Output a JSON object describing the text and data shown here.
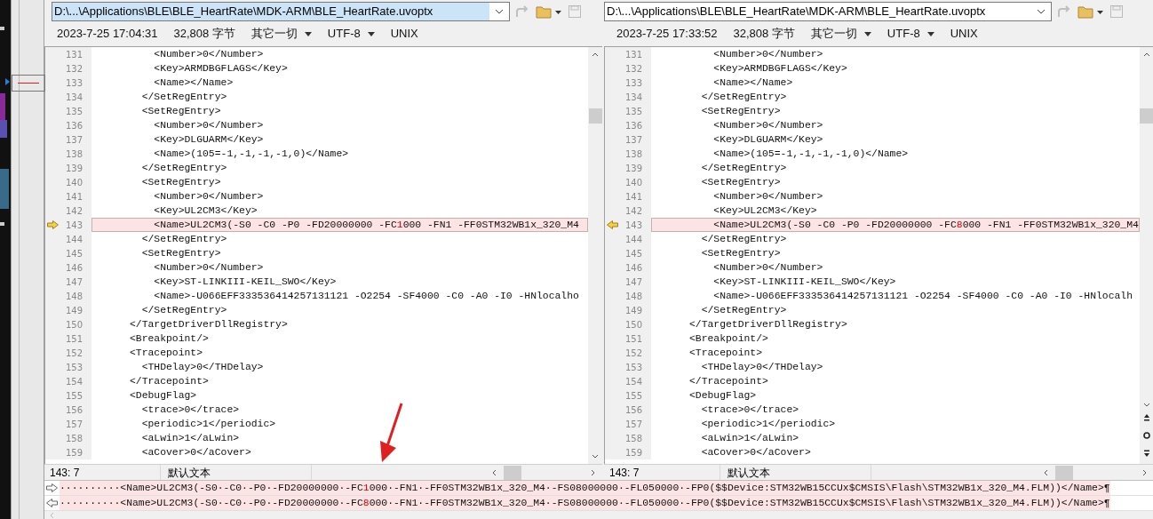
{
  "panes": [
    {
      "path": "D:\\...\\Applications\\BLE\\BLE_HeartRate\\MDK-ARM\\BLE_HeartRate.uvoptx",
      "selected": true,
      "timestamp": "2023-7-25 17:04:31",
      "size": "32,808 字节",
      "filter": "其它一切",
      "encoding": "UTF-8",
      "line_ending": "UNIX",
      "position": "143: 7",
      "syntax": "默认文本",
      "lines": [
        {
          "number": "131",
          "kind": "same",
          "text": "          <Number>0</Number>"
        },
        {
          "number": "132",
          "kind": "same",
          "text": "          <Key>ARMDBGFLAGS</Key>"
        },
        {
          "number": "133",
          "kind": "same",
          "text": "          <Name></Name>"
        },
        {
          "number": "134",
          "kind": "same",
          "text": "        </SetRegEntry>"
        },
        {
          "number": "135",
          "kind": "same",
          "text": "        <SetRegEntry>"
        },
        {
          "number": "136",
          "kind": "same",
          "text": "          <Number>0</Number>"
        },
        {
          "number": "137",
          "kind": "same",
          "text": "          <Key>DLGUARM</Key>"
        },
        {
          "number": "138",
          "kind": "same",
          "text": "          <Name>(105=-1,-1,-1,-1,0)</Name>"
        },
        {
          "number": "139",
          "kind": "same",
          "text": "        </SetRegEntry>"
        },
        {
          "number": "140",
          "kind": "same",
          "text": "        <SetRegEntry>"
        },
        {
          "number": "141",
          "kind": "same",
          "text": "          <Number>0</Number>"
        },
        {
          "number": "142",
          "kind": "same",
          "text": "          <Key>UL2CM3</Key>"
        },
        {
          "number": "143",
          "kind": "changed",
          "parts": [
            {
              "text": "          <Name>UL2CM3(-S0 -C0 -P0 -FD20000000 -FC",
              "changed": false
            },
            {
              "text": "1",
              "changed": true
            },
            {
              "text": "000 -FN1 -FF0STM32WB1x_320_M4",
              "changed": false
            }
          ]
        },
        {
          "number": "144",
          "kind": "same",
          "text": "        </SetRegEntry>"
        },
        {
          "number": "145",
          "kind": "same",
          "text": "        <SetRegEntry>"
        },
        {
          "number": "146",
          "kind": "same",
          "text": "          <Number>0</Number>"
        },
        {
          "number": "147",
          "kind": "same",
          "text": "          <Key>ST-LINKIII-KEIL_SWO</Key>"
        },
        {
          "number": "148",
          "kind": "same",
          "text": "          <Name>-U066EFF333536414257131121 -O2254 -SF4000 -C0 -A0 -I0 -HNlocalho"
        },
        {
          "number": "149",
          "kind": "same",
          "text": "        </SetRegEntry>"
        },
        {
          "number": "150",
          "kind": "same",
          "text": "      </TargetDriverDllRegistry>"
        },
        {
          "number": "151",
          "kind": "same",
          "text": "      <Breakpoint/>"
        },
        {
          "number": "152",
          "kind": "same",
          "text": "      <Tracepoint>"
        },
        {
          "number": "153",
          "kind": "same",
          "text": "        <THDelay>0</THDelay>"
        },
        {
          "number": "154",
          "kind": "same",
          "text": "      </Tracepoint>"
        },
        {
          "number": "155",
          "kind": "same",
          "text": "      <DebugFlag>"
        },
        {
          "number": "156",
          "kind": "same",
          "text": "        <trace>0</trace>"
        },
        {
          "number": "157",
          "kind": "same",
          "text": "        <periodic>1</periodic>"
        },
        {
          "number": "158",
          "kind": "same",
          "text": "        <aLwin>1</aLwin>"
        },
        {
          "number": "159",
          "kind": "same",
          "text": "        <aCover>0</aCover>"
        }
      ]
    },
    {
      "path": "D:\\...\\Applications\\BLE\\BLE_HeartRate\\MDK-ARM\\BLE_HeartRate.uvoptx",
      "selected": false,
      "timestamp": "2023-7-25 17:33:52",
      "size": "32,808 字节",
      "filter": "其它一切",
      "encoding": "UTF-8",
      "line_ending": "UNIX",
      "position": "143: 7",
      "syntax": "默认文本",
      "lines": [
        {
          "number": "131",
          "kind": "same",
          "text": "          <Number>0</Number>"
        },
        {
          "number": "132",
          "kind": "same",
          "text": "          <Key>ARMDBGFLAGS</Key>"
        },
        {
          "number": "133",
          "kind": "same",
          "text": "          <Name></Name>"
        },
        {
          "number": "134",
          "kind": "same",
          "text": "        </SetRegEntry>"
        },
        {
          "number": "135",
          "kind": "same",
          "text": "        <SetRegEntry>"
        },
        {
          "number": "136",
          "kind": "same",
          "text": "          <Number>0</Number>"
        },
        {
          "number": "137",
          "kind": "same",
          "text": "          <Key>DLGUARM</Key>"
        },
        {
          "number": "138",
          "kind": "same",
          "text": "          <Name>(105=-1,-1,-1,-1,0)</Name>"
        },
        {
          "number": "139",
          "kind": "same",
          "text": "        </SetRegEntry>"
        },
        {
          "number": "140",
          "kind": "same",
          "text": "        <SetRegEntry>"
        },
        {
          "number": "141",
          "kind": "same",
          "text": "          <Number>0</Number>"
        },
        {
          "number": "142",
          "kind": "same",
          "text": "          <Key>UL2CM3</Key>"
        },
        {
          "number": "143",
          "kind": "changed",
          "parts": [
            {
              "text": "          <Name>UL2CM3(-S0 -C0 -P0 -FD20000000 -FC",
              "changed": false
            },
            {
              "text": "8",
              "changed": true
            },
            {
              "text": "000 -FN1 -FF0STM32WB1x_320_M4",
              "changed": false
            }
          ]
        },
        {
          "number": "144",
          "kind": "same",
          "text": "        </SetRegEntry>"
        },
        {
          "number": "145",
          "kind": "same",
          "text": "        <SetRegEntry>"
        },
        {
          "number": "146",
          "kind": "same",
          "text": "          <Number>0</Number>"
        },
        {
          "number": "147",
          "kind": "same",
          "text": "          <Key>ST-LINKIII-KEIL_SWO</Key>"
        },
        {
          "number": "148",
          "kind": "same",
          "text": "          <Name>-U066EFF333536414257131121 -O2254 -SF4000 -C0 -A0 -I0 -HNlocalh"
        },
        {
          "number": "149",
          "kind": "same",
          "text": "        </SetRegEntry>"
        },
        {
          "number": "150",
          "kind": "same",
          "text": "      </TargetDriverDllRegistry>"
        },
        {
          "number": "151",
          "kind": "same",
          "text": "      <Breakpoint/>"
        },
        {
          "number": "152",
          "kind": "same",
          "text": "      <Tracepoint>"
        },
        {
          "number": "153",
          "kind": "same",
          "text": "        <THDelay>0</THDelay>"
        },
        {
          "number": "154",
          "kind": "same",
          "text": "      </Tracepoint>"
        },
        {
          "number": "155",
          "kind": "same",
          "text": "      <DebugFlag>"
        },
        {
          "number": "156",
          "kind": "same",
          "text": "        <trace>0</trace>"
        },
        {
          "number": "157",
          "kind": "same",
          "text": "        <periodic>1</periodic>"
        },
        {
          "number": "158",
          "kind": "same",
          "text": "        <aLwin>1</aLwin>"
        },
        {
          "number": "159",
          "kind": "same",
          "text": "        <aCover>0</aCover>"
        }
      ]
    }
  ],
  "compare_lines": [
    {
      "parts": [
        {
          "text": "··········<Name>UL2CM3(-S0·-C0·-P0·-FD20000000·-FC",
          "changed": false
        },
        {
          "text": "1",
          "changed": true
        },
        {
          "text": "000·-FN1·-FF0STM32WB1x_320_M4·-FS08000000·-FL050000·-FP0($$Device:STM32WB15CCUx$CMSIS\\Flash\\STM32WB1x_320_M4.FLM))</Name>¶",
          "changed": false
        }
      ]
    },
    {
      "parts": [
        {
          "text": "··········<Name>UL2CM3(-S0·-C0·-P0·-FD20000000·-FC",
          "changed": false
        },
        {
          "text": "8",
          "changed": true
        },
        {
          "text": "000·-FN1·-FF0STM32WB1x_320_M4·-FS08000000·-FL050000·-FP0($$Device:STM32WB15CCUx$CMSIS\\Flash\\STM32WB1x_320_M4.FLM))</Name>¶",
          "changed": false
        }
      ]
    }
  ]
}
